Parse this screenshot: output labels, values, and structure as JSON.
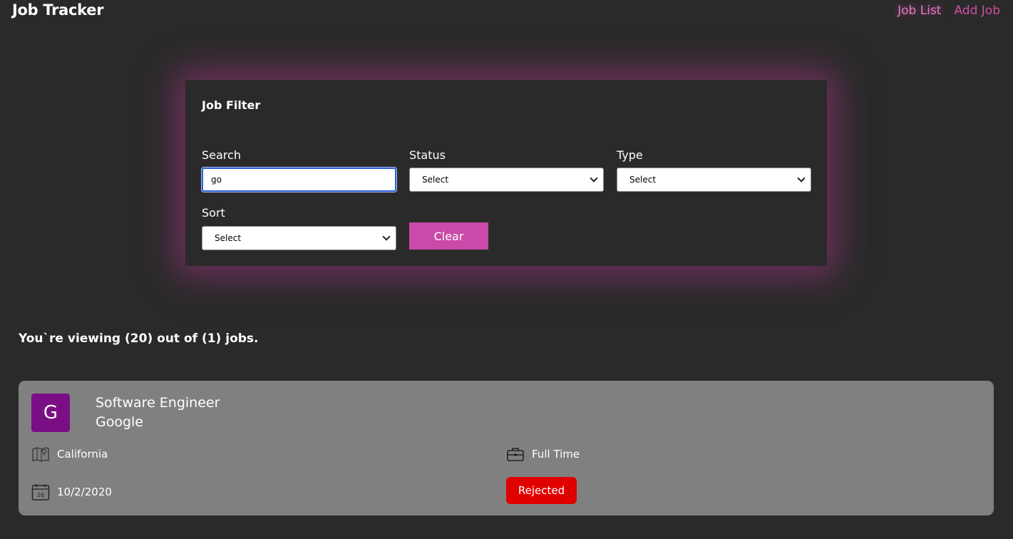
{
  "app": {
    "title": "Job Tracker",
    "nav": [
      {
        "label": "Job List",
        "active": true
      },
      {
        "label": "Add Job",
        "active": false
      }
    ]
  },
  "filter": {
    "title": "Job Filter",
    "search": {
      "label": "Search",
      "value": "go"
    },
    "status": {
      "label": "Status",
      "selected": "Select"
    },
    "type": {
      "label": "Type",
      "selected": "Select"
    },
    "sort": {
      "label": "Sort",
      "selected": "Select"
    },
    "clear_label": "Clear"
  },
  "summary": "You`re viewing (20) out of (1) jobs.",
  "jobs": [
    {
      "initial": "G",
      "title": "Software Engineer",
      "company": "Google",
      "location": "California",
      "job_type": "Full Time",
      "date": "10/2/2020",
      "calendar_day": "26",
      "status": "Rejected"
    }
  ],
  "colors": {
    "accent": "#d04fa6",
    "button": "#c94aa8",
    "background": "#2a2a2a",
    "card": "#808080",
    "avatar": "#7a0f85",
    "status_rejected": "#e00000"
  },
  "icons": {
    "location": "map-icon",
    "job_type": "briefcase-icon",
    "date": "calendar-icon"
  }
}
